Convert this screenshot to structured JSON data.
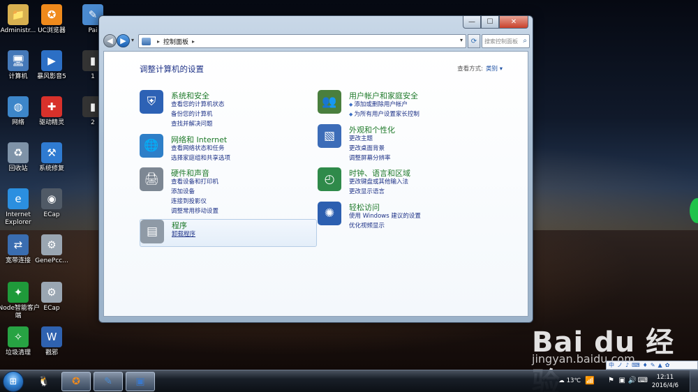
{
  "desktop_icons": [
    {
      "label": "Administr...",
      "icon": "user-folder-icon",
      "color": "#d8b050"
    },
    {
      "label": "UC浏览器",
      "icon": "uc-browser-icon",
      "color": "#f08a1c"
    },
    {
      "label": "Pai",
      "icon": "paint-icon",
      "color": "#4a8ad0"
    },
    {
      "label": "计算机",
      "icon": "computer-icon",
      "color": "#4478b8"
    },
    {
      "label": "暴风影音5",
      "icon": "baofeng-icon",
      "color": "#2c6fc5"
    },
    {
      "label": "1",
      "icon": "partial-icon",
      "color": "#333333"
    },
    {
      "label": "网络",
      "icon": "network-icon",
      "color": "#3d86c9"
    },
    {
      "label": "驱动精灵",
      "icon": "driver-genius-icon",
      "color": "#d8312b"
    },
    {
      "label": "2",
      "icon": "partial-icon",
      "color": "#333333"
    },
    {
      "label": "回收站",
      "icon": "recycle-bin-icon",
      "color": "#7f93a8"
    },
    {
      "label": "系统修复",
      "icon": "system-repair-icon",
      "color": "#2f7bd1"
    },
    {
      "label": "Internet Explorer",
      "icon": "ie-icon",
      "color": "#2b8fe0"
    },
    {
      "label": "ECap",
      "icon": "camera-icon",
      "color": "#505a66"
    },
    {
      "label": "宽带连接",
      "icon": "broadband-icon",
      "color": "#3a6db0"
    },
    {
      "label": "GenePcc...",
      "icon": "gear-document-icon",
      "color": "#9aa6b2"
    },
    {
      "label": "iNode智能客户端",
      "icon": "inode-icon",
      "color": "#1f9a3a"
    },
    {
      "label": "ECap",
      "icon": "gear-document-icon",
      "color": "#9aa6b2"
    },
    {
      "label": "垃圾清理",
      "icon": "cleaner-icon",
      "color": "#27a343"
    },
    {
      "label": "戳邪",
      "icon": "word-document-icon",
      "color": "#2f62b0"
    }
  ],
  "window": {
    "title_buttons": {
      "minimize": "—",
      "maximize": "☐",
      "close": "✕"
    },
    "address_bar": {
      "location": "控制面板",
      "separator": "▸"
    },
    "search": {
      "placeholder": "搜索控制面板"
    },
    "page_title": "调整计算机的设置",
    "view_by_label": "查看方式:",
    "view_by_value": "类别 ▾"
  },
  "categories_left": [
    {
      "title": "系统和安全",
      "icon": "shield-icon",
      "color": "#2d62b5",
      "links": [
        "查看您的计算机状态",
        "备份您的计算机",
        "查找并解决问题"
      ]
    },
    {
      "title": "网络和 Internet",
      "icon": "globe-network-icon",
      "color": "#2e7fc8",
      "links": [
        "查看网络状态和任务",
        "选择家庭组和共享选项"
      ]
    },
    {
      "title": "硬件和声音",
      "icon": "printer-icon",
      "color": "#7d8793",
      "links": [
        "查看设备和打印机",
        "添加设备",
        "连接到投影仪",
        "调整常用移动设置"
      ]
    },
    {
      "title": "程序",
      "icon": "programs-icon",
      "color": "#8f9aa6",
      "links": [
        "卸载程序"
      ]
    }
  ],
  "categories_right": [
    {
      "title": "用户帐户和家庭安全",
      "icon": "users-icon",
      "color": "#4a7f3e",
      "links": [
        "添加或删除用户帐户",
        "为所有用户设置家长控制"
      ]
    },
    {
      "title": "外观和个性化",
      "icon": "appearance-icon",
      "color": "#3c6cb8",
      "links": [
        "更改主题",
        "更改桌面背景",
        "调整屏幕分辨率"
      ]
    },
    {
      "title": "时钟、语言和区域",
      "icon": "clock-globe-icon",
      "color": "#2f8a4a",
      "links": [
        "更改键盘或其他输入法",
        "更改显示语言"
      ]
    },
    {
      "title": "轻松访问",
      "icon": "accessibility-icon",
      "color": "#2c5fb0",
      "links": [
        "使用 Windows 建议的设置",
        "优化视频显示"
      ]
    }
  ],
  "watermark": {
    "brand": "Bai du 经验",
    "url": "jingyan.baidu.com"
  },
  "ime_bar": [
    "中",
    "ノ",
    "♪",
    "⌨",
    "♦",
    "✎",
    "▲",
    "✿"
  ],
  "taskbar": {
    "apps": [
      {
        "icon": "qq-icon",
        "color": "#e0a20c"
      },
      {
        "icon": "uc-browser-icon",
        "color": "#f08a1c"
      },
      {
        "icon": "paint-icon",
        "color": "#4a8ad0"
      },
      {
        "icon": "control-panel-icon",
        "color": "#3c78c8"
      }
    ],
    "weather": "13℃",
    "time": "12:11",
    "date": "2016/4/6"
  }
}
